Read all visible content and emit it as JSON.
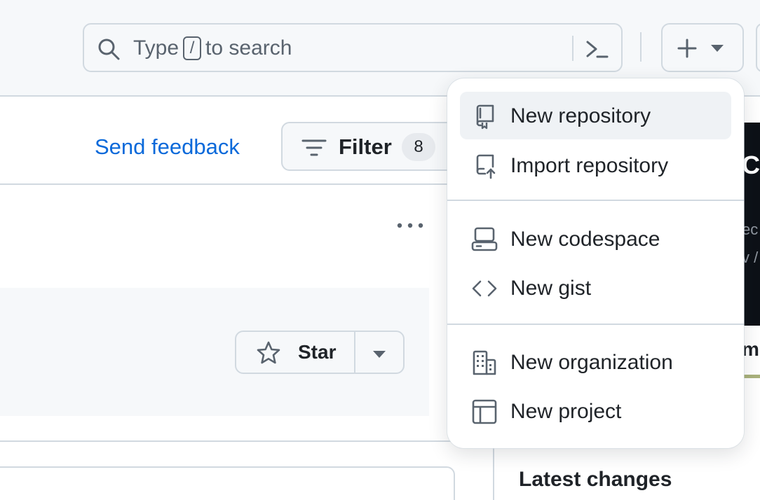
{
  "header": {
    "search_placeholder_prefix": "Type",
    "search_shortcut_key": "/",
    "search_placeholder_suffix": "to search"
  },
  "feed": {
    "send_feedback": "Send feedback",
    "filter_label": "Filter",
    "filter_count": "8",
    "star_label": "Star"
  },
  "side": {
    "promo_title": "Co",
    "promo_line1": "ec",
    "promo_line2": "v /",
    "promo_heading": "m",
    "latest_changes": "Latest changes"
  },
  "menu": {
    "items": [
      {
        "label": "New repository",
        "icon": "repo-icon",
        "active": true
      },
      {
        "label": "Import repository",
        "icon": "repo-push-icon"
      },
      {
        "label": "New codespace",
        "icon": "codespaces-icon"
      },
      {
        "label": "New gist",
        "icon": "code-icon"
      },
      {
        "label": "New organization",
        "icon": "organization-icon"
      },
      {
        "label": "New project",
        "icon": "table-icon"
      }
    ]
  },
  "colors": {
    "link": "#0969da",
    "border": "#d1d9e0",
    "canvas_subtle": "#f6f8fa",
    "text": "#1f2328",
    "muted": "#59636e"
  }
}
